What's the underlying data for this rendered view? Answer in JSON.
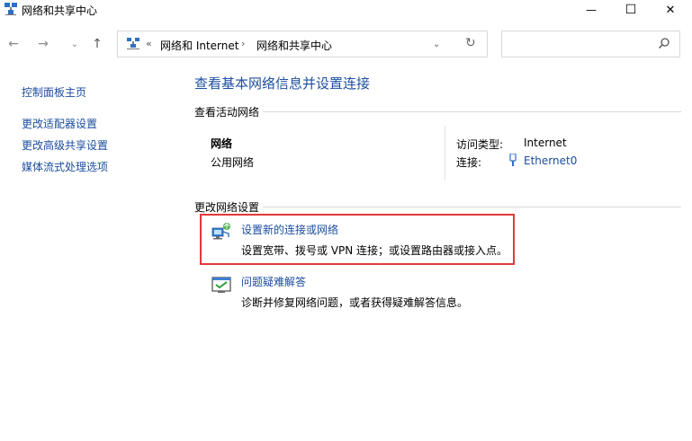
{
  "window": {
    "title": "网络和共享中心",
    "controls": {
      "minimize": "—",
      "maximize": "☐",
      "close": "✕"
    }
  },
  "nav": {
    "back": "←",
    "forward": "→",
    "recent": "⌄",
    "up": "↑",
    "address": {
      "chevron": "«",
      "breadcrumbs": [
        "网络和 Internet",
        "网络和共享中心"
      ],
      "separator": "›",
      "dropdown": "⌄",
      "refresh": "↻"
    },
    "search": {
      "placeholder": ""
    }
  },
  "sidebar": {
    "items": [
      {
        "label": "控制面板主页"
      },
      {
        "label": "更改适配器设置"
      },
      {
        "label": "更改高级共享设置"
      },
      {
        "label": "媒体流式处理选项"
      }
    ]
  },
  "main": {
    "title": "查看基本网络信息并设置连接",
    "active_section": {
      "header": "查看活动网络",
      "network_name": "网络",
      "network_profile": "公用网络",
      "access_type_label": "访问类型:",
      "access_type_value": "Internet",
      "connection_label": "连接:",
      "connection_value": "Ethernet0"
    },
    "change_section": {
      "header": "更改网络设置",
      "items": [
        {
          "title": "设置新的连接或网络",
          "desc": "设置宽带、拨号或 VPN 连接；或设置路由器或接入点。",
          "icon": "network-setup-icon"
        },
        {
          "title": "问题疑难解答",
          "desc": "诊断并修复网络问题，或者获得疑难解答信息。",
          "icon": "troubleshoot-icon"
        }
      ]
    }
  },
  "colors": {
    "link": "#1a4c9e",
    "title": "#1e4fa0",
    "highlight": "#e0393b"
  }
}
